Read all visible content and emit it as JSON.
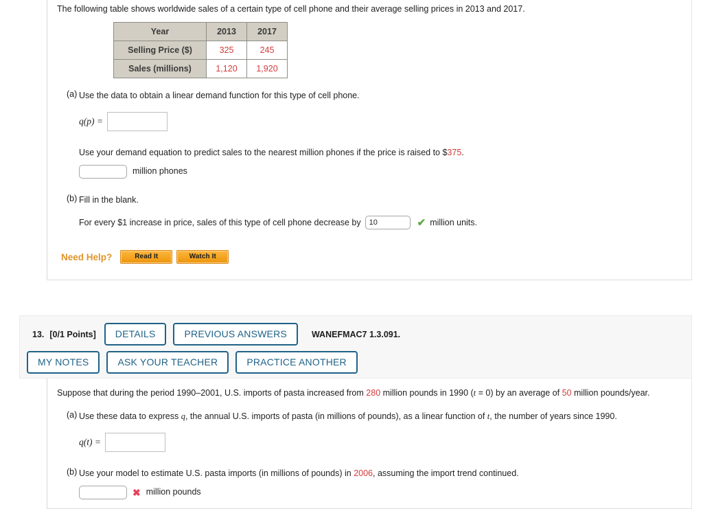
{
  "question12": {
    "prompt": "The following table shows worldwide sales of a certain type of cell phone and their average selling prices in 2013 and 2017.",
    "table": {
      "header": [
        "Year",
        "2013",
        "2017"
      ],
      "rows": [
        {
          "label": "Selling Price ($)",
          "values": [
            "325",
            "245"
          ]
        },
        {
          "label": "Sales (millions)",
          "values": [
            "1,120",
            "1,920"
          ]
        }
      ]
    },
    "parts": [
      {
        "letter": "(a)",
        "text": "Use the data to obtain a linear demand function for this type of cell phone.",
        "fn_label_pre": "q(",
        "fn_var": "p",
        "fn_label_post": ") =",
        "answer_value": "",
        "followup_pre": "Use your demand equation to predict sales to the nearest million phones if the price is raised to $",
        "followup_highlight": "375",
        "followup_post": ".",
        "followup_answer": "",
        "followup_unit": "million phones"
      },
      {
        "letter": "(b)",
        "text": "Fill in the blank.",
        "fill_pre": "For every $1 increase in price, sales of this type of cell phone decrease by",
        "fill_value": "10",
        "fill_mark": "✔",
        "fill_post": "million units."
      }
    ],
    "need_help": {
      "label": "Need Help?",
      "buttons": [
        "Read It",
        "Watch It"
      ]
    }
  },
  "question13": {
    "header": {
      "number": "13.",
      "points": "[0/1 Points]",
      "buttons_row1": [
        "DETAILS",
        "PREVIOUS ANSWERS"
      ],
      "code": "WANEFMAC7 1.3.091.",
      "buttons_row2": [
        "MY NOTES",
        "ASK YOUR TEACHER",
        "PRACTICE ANOTHER"
      ]
    },
    "prompt_part1": "Suppose that during the period 1990–2001, U.S. imports of pasta increased from",
    "prompt_num1": "280",
    "prompt_part2": "million pounds in 1990 (",
    "prompt_var": "t",
    "prompt_part3": " = 0) by an average of",
    "prompt_num2": "50",
    "prompt_part4": "million pounds/year.",
    "parts": [
      {
        "letter": "(a)",
        "text_pre": "Use these data to express",
        "var1": "q",
        "text_mid": ", the annual U.S. imports of pasta (in millions of pounds), as a linear function of",
        "var2": "t",
        "text_post": ", the number of years since 1990.",
        "fn_label_pre": "q(",
        "fn_var": "t",
        "fn_label_post": ") =",
        "answer_value": ""
      },
      {
        "letter": "(b)",
        "text_pre": "Use your model to estimate U.S. pasta imports (in millions of pounds) in",
        "highlight": "2006",
        "text_post": ", assuming the import trend continued.",
        "answer_value": "",
        "mark": "✖",
        "unit": "million pounds"
      }
    ]
  },
  "colors": {
    "accent_red": "#d33a3a",
    "accent_blue": "#1f6287",
    "accent_orange": "#e0952a",
    "correct_green": "#5fa93f",
    "incorrect_red": "#e8415a"
  }
}
